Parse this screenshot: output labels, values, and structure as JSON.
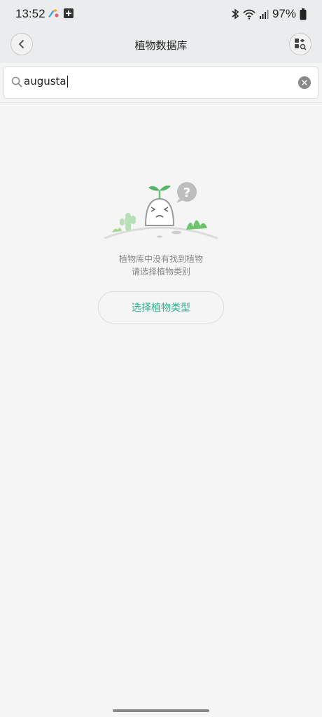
{
  "status_bar": {
    "time": "13:52",
    "battery": "97%"
  },
  "header": {
    "title": "植物数据库"
  },
  "search": {
    "value": "augusta"
  },
  "empty_state": {
    "line1": "植物库中没有找到植物",
    "line2": "请选择植物类别"
  },
  "actions": {
    "choose_button": "选择植物类型"
  },
  "colors": {
    "accent": "#2bb28d",
    "header_bg": "#ebeced",
    "page_bg": "#f5f5f5"
  },
  "icons": [
    "back-icon",
    "plant-scan-icon",
    "search-icon",
    "clear-icon",
    "bluetooth-icon",
    "wifi-icon",
    "signal-icon",
    "battery-icon"
  ]
}
